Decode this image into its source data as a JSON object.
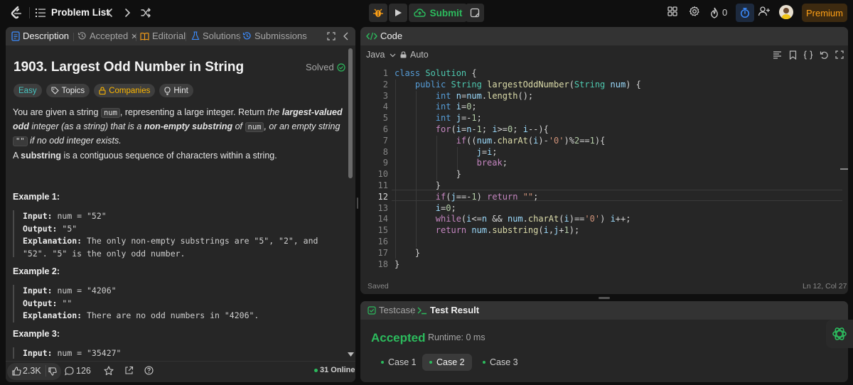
{
  "nav": {
    "problem_list": "Problem List",
    "submit": "Submit",
    "streak_count": "0",
    "premium": "Premium"
  },
  "left_tabs": {
    "description": "Description",
    "accepted": "Accepted",
    "editorial": "Editorial",
    "solutions": "Solutions",
    "submissions": "Submissions"
  },
  "problem": {
    "title": "1903. Largest Odd Number in String",
    "status": "Solved",
    "tags": [
      "Easy",
      "Topics",
      "Companies",
      "Hint"
    ],
    "p1_a": "You are given a string ",
    "p1_code1": "num",
    "p1_b": ", representing a large integer. Return ",
    "p1_em1a": "the ",
    "p1_strong1": "largest-valued odd",
    "p1_em1b": " integer (as a string) that is a ",
    "p1_strong2": "non-empty substring",
    "p1_em1c": " of ",
    "p1_code2": "num",
    "p1_em1d": ", or an empty string ",
    "p1_code3": "\"\"",
    "p1_em1e": " if no odd integer exists.",
    "p2_a": "A ",
    "p2_strong": "substring",
    "p2_b": " is a contiguous sequence of characters within a string.",
    "examples": [
      {
        "heading": "Example 1:",
        "input_label": "Input:",
        "input": " num = \"52\"",
        "output_label": "Output:",
        "output": " \"5\"",
        "expl_label": "Explanation:",
        "expl": " The only non-empty substrings are \"5\", \"2\", and \"52\". \"5\" is the only odd number."
      },
      {
        "heading": "Example 2:",
        "input_label": "Input:",
        "input": " num = \"4206\"",
        "output_label": "Output:",
        "output": " \"\"",
        "expl_label": "Explanation:",
        "expl": " There are no odd numbers in \"4206\"."
      },
      {
        "heading": "Example 3:",
        "input_label": "Input:",
        "input": " num = \"35427\""
      }
    ]
  },
  "footer": {
    "likes": "2.3K",
    "comments": "126",
    "online": "31 Online"
  },
  "code_panel": {
    "tab": "Code",
    "language": "Java",
    "mode": "Auto",
    "status_left": "Saved",
    "status_right": "Ln 12, Col 27",
    "line_numbers": [
      "1",
      "2",
      "3",
      "4",
      "5",
      "6",
      "7",
      "8",
      "9",
      "10",
      "11",
      "12",
      "13",
      "14",
      "15",
      "16",
      "17",
      "18"
    ]
  },
  "result_panel": {
    "tab_testcase": "Testcase",
    "tab_result": "Test Result",
    "verdict": "Accepted",
    "runtime": "Runtime: 0 ms",
    "cases": [
      "Case 1",
      "Case 2",
      "Case 3"
    ]
  },
  "colors": {
    "accent_green": "#2cbb5d",
    "easy": "#46c6c2",
    "premium": "#ffa116",
    "companies": "#ffb800"
  }
}
